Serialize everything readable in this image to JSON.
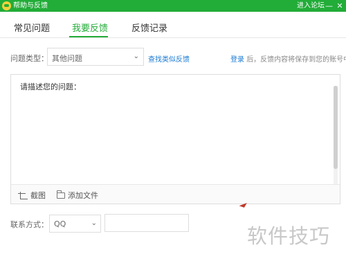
{
  "window": {
    "title": "帮助与反馈",
    "forum_link": "进入论坛",
    "minimize_glyph": "—",
    "close_glyph": "✕",
    "accent_color": "#22ac38"
  },
  "tabs": [
    {
      "label": "常见问题",
      "active": false
    },
    {
      "label": "我要反馈",
      "active": true
    },
    {
      "label": "反馈记录",
      "active": false
    }
  ],
  "feedback_form": {
    "type_label": "问题类型：",
    "type_selected": "其他问题",
    "similar_link": "查找类似反馈",
    "login_link": "登录",
    "login_note": "后，反馈内容将保存到您的账号中",
    "description_prompt": "请描述您的问题：",
    "toolbar": {
      "screenshot_label": "截图",
      "attach_label": "添加文件"
    },
    "contact_label": "联系方式：",
    "contact_selected": "QQ",
    "contact_value": ""
  },
  "watermark": "软件技巧",
  "icons": {
    "logo": "app-logo-icon",
    "screenshot": "crop-icon",
    "attach": "folder-icon",
    "dropdown": "chevron-down-icon"
  }
}
